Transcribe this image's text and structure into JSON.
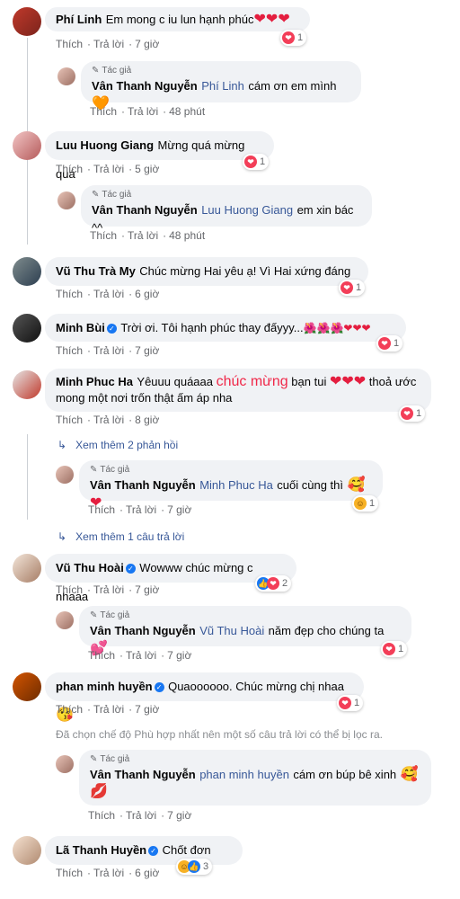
{
  "labels": {
    "like": "Thích",
    "reply": "Trả lời",
    "author": "Tác giả"
  },
  "comments": [
    {
      "name": "Phí Linh",
      "text": "Em mong c iu lun hạnh phúc",
      "emoji": "❤❤❤",
      "time": "7 giờ",
      "reacts": "1"
    },
    {
      "name": "Vân Thanh Nguyễn",
      "tag": "Phí Linh",
      "text": "cám ơn em mình",
      "emoji": "🧡",
      "time": "48 phút"
    },
    {
      "name": "Luu Huong Giang",
      "text": "Mừng quá mừng quá",
      "time": "5 giờ",
      "reacts": "1"
    },
    {
      "name": "Vân Thanh Nguyễn",
      "tag": "Luu Huong Giang",
      "text": "em xin bác ^^",
      "time": "48 phút"
    },
    {
      "name": "Vũ Thu Trà My",
      "text": "Chúc mừng Hai yêu ạ! Vì Hai xứng đáng",
      "time": "6 giờ",
      "reacts": "1"
    },
    {
      "name": "Minh Bùi",
      "text": "Trời ơi. Tôi hạnh phúc thay đấyyy...",
      "emoji": "🌺🌺🌺❤❤❤",
      "time": "7 giờ",
      "reacts": "1"
    },
    {
      "name": "Minh Phuc Ha",
      "text1": "Yêuuu quáaaa ",
      "highlight": "chúc mừng",
      "text2": " bạn tui ",
      "emoji": "❤❤❤",
      "text3": " thoả ước",
      "line2": "mong một nơi trốn thật ấm áp nha",
      "time": "8 giờ",
      "reacts": "1"
    },
    {
      "more": "Xem thêm 2 phản hồi"
    },
    {
      "name": "Vân Thanh Nguyễn",
      "tag": "Minh Phuc Ha",
      "text": "cuối cùng thì",
      "emoji": "🥰❤",
      "time": "7 giờ",
      "reacts": "1"
    },
    {
      "more": "Xem thêm 1 câu trả lời"
    },
    {
      "name": "Vũ Thu Hoài",
      "text": "Wowww chúc mừng c nhaaa",
      "time": "7 giờ",
      "reacts": "2"
    },
    {
      "name": "Vân Thanh Nguyễn",
      "tag": "Vũ Thu Hoài",
      "text": "năm đẹp cho chúng ta",
      "emoji": "💕",
      "time": "7 giờ",
      "reacts": "1"
    },
    {
      "name": "phan minh huyền",
      "text": "Quaoooooo. Chúc mừng chị nhaa",
      "emoji": "😘",
      "time": "7 giờ",
      "reacts": "1"
    },
    {
      "notice": "Đã chọn chế độ Phù hợp nhất nên một số câu trả lời có thể bị lọc ra."
    },
    {
      "name": "Vân Thanh Nguyễn",
      "tag": "phan minh huyền",
      "text": "cám ơn búp bê xinh",
      "emoji": "🥰",
      "line2emoji": "💋",
      "time": "7 giờ"
    },
    {
      "name": "Lã Thanh Huyền",
      "text": "Chốt đơn",
      "time": "6 giờ",
      "reacts": "3"
    }
  ]
}
